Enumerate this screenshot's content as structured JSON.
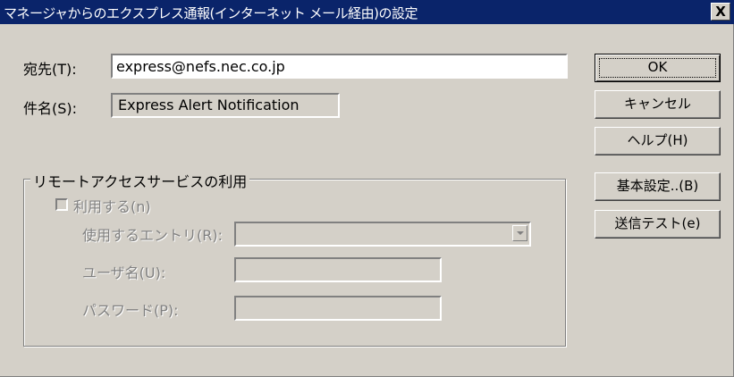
{
  "window": {
    "title": "マネージャからのエクスプレス通報(インターネット メール経由)の設定",
    "close_label": "X"
  },
  "form": {
    "destination_label": "宛先(T):",
    "destination_value": "express@nefs.nec.co.jp",
    "subject_label": "件名(S):",
    "subject_value": "Express Alert Notification"
  },
  "remote_access": {
    "group_title": "リモートアクセスサービスの利用",
    "use_label": "利用する(n)",
    "use_checked": false,
    "entry_label": "使用するエントリ(R):",
    "entry_value": "",
    "username_label": "ユーザ名(U):",
    "username_value": "",
    "password_label": "パスワード(P):",
    "password_value": ""
  },
  "buttons": {
    "ok": "OK",
    "cancel": "キャンセル",
    "help": "ヘルプ(H)",
    "basic_settings": "基本設定..(B)",
    "send_test": "送信テスト(e)"
  }
}
